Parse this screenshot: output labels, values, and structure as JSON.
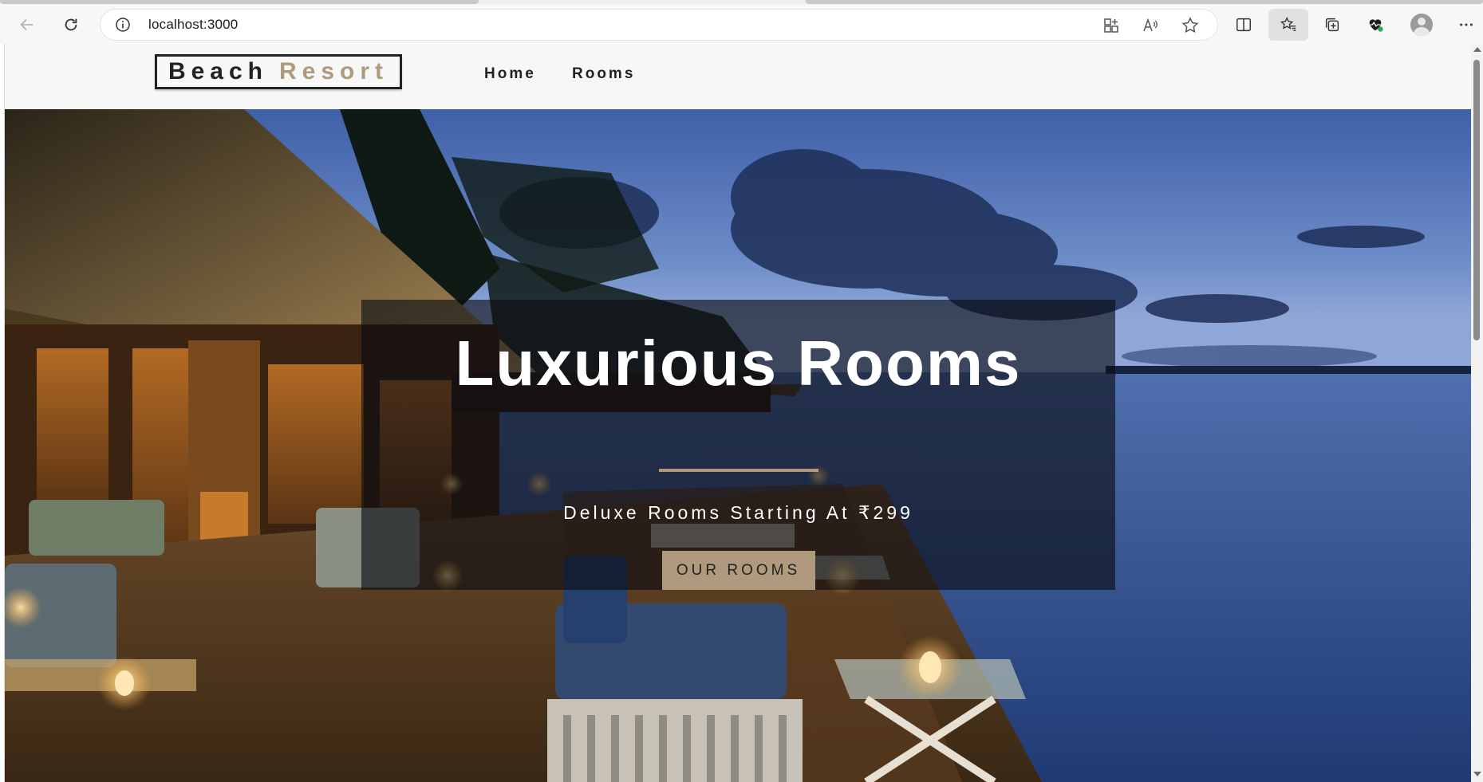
{
  "browser": {
    "url": "localhost:3000",
    "accent": "#f7f7f7"
  },
  "navbar": {
    "logo_word1": "Beach",
    "logo_word2": "Resort",
    "links": [
      "Home",
      "Rooms"
    ]
  },
  "hero": {
    "title": "Luxurious Rooms",
    "subtitle": "Deluxe Rooms Starting At ₹299",
    "button_label": "OUR ROOMS"
  },
  "colors": {
    "primary": "#af9a7d",
    "dark": "#222222",
    "navbar_bg": "#f7f7f7",
    "banner_overlay": "rgba(10,12,18,0.62)"
  },
  "icons": [
    "back-arrow-icon",
    "refresh-icon",
    "info-icon",
    "grid-icon",
    "read-aloud-icon",
    "star-icon",
    "split-screen-icon",
    "favorites-icon",
    "collections-icon",
    "health-icon",
    "profile-icon",
    "more-icon"
  ]
}
